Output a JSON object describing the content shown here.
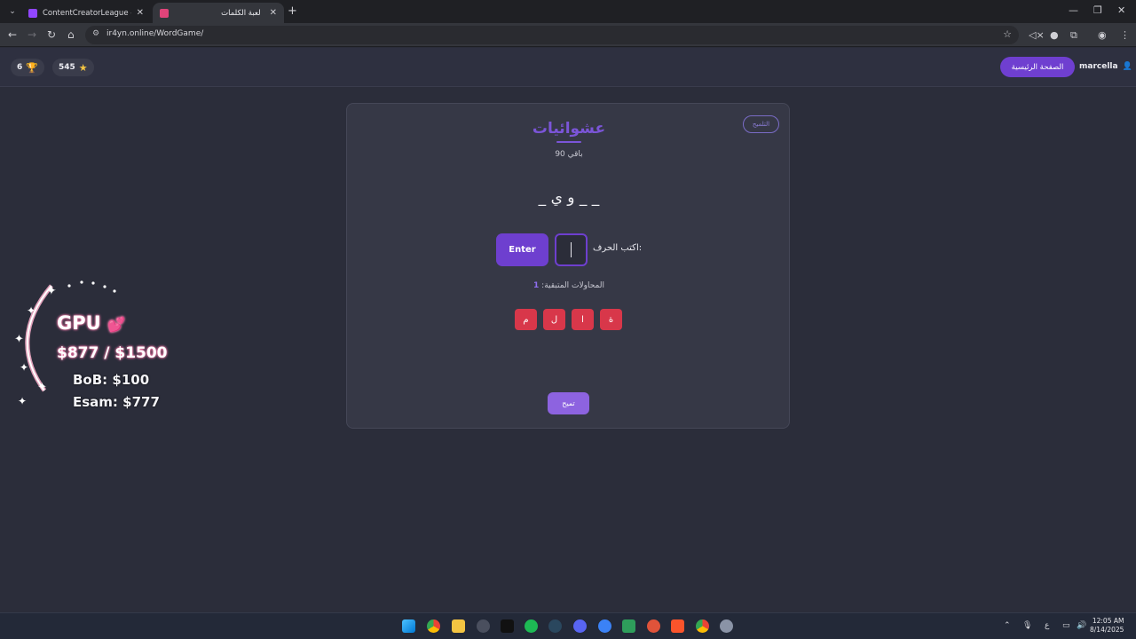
{
  "browser": {
    "tabs": [
      {
        "title": "ContentCreatorLeague - Twitch",
        "favicon_color": "#9146ff"
      },
      {
        "title": "لعبة الكلمات",
        "favicon_color": "#e0447a"
      }
    ],
    "url": "ir4yn.online/WordGame/"
  },
  "header": {
    "trophies": "6",
    "stars": "545",
    "home_label": "الصفحة الرئيسية",
    "username": "marcella"
  },
  "game": {
    "hint_label": "التلميح",
    "category": "عشوائيات",
    "remaining": "باقي 90",
    "pattern": "_ و ي _ _",
    "enter_label": "Enter",
    "input_label": "اكتب الحرف:",
    "input_value": "",
    "attempts_label": "المحاولات المتبقية:",
    "attempts_value": "1",
    "guessed_letters": [
      "ة",
      "ا",
      "ل",
      "م"
    ],
    "submit_label": "تميح"
  },
  "overlay": {
    "gpu_label": "GPU",
    "gpu_amount": "$877 / $1500",
    "bob": "BoB: $100",
    "esam": "Esam: $777"
  },
  "taskbar": {
    "time": "12:05 AM",
    "date": "8/14/2025",
    "lang": "ع"
  },
  "colors": {
    "accent": "#6f3fd0",
    "guessed_chip": "#d8374a"
  }
}
